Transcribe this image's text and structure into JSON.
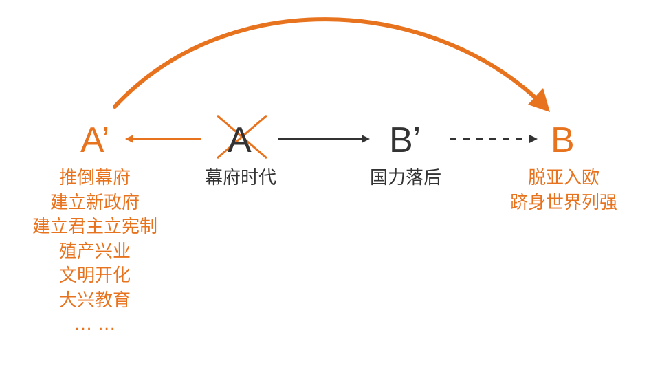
{
  "nodes": {
    "a_prime": "A’",
    "a": "A",
    "b_prime": "B’",
    "b": "B"
  },
  "captions": {
    "a": "幕府时代",
    "b_prime": "国力落后"
  },
  "a_prime_list": [
    "推倒幕府",
    "建立新政府",
    "建立君主立宪制",
    "殖产兴业",
    "文明开化",
    "大兴教育",
    "…  …"
  ],
  "b_list": [
    "脱亚入欧",
    "跻身世界列强"
  ],
  "colors": {
    "accent": "#e8731f",
    "text": "#333333",
    "line": "#333333"
  }
}
